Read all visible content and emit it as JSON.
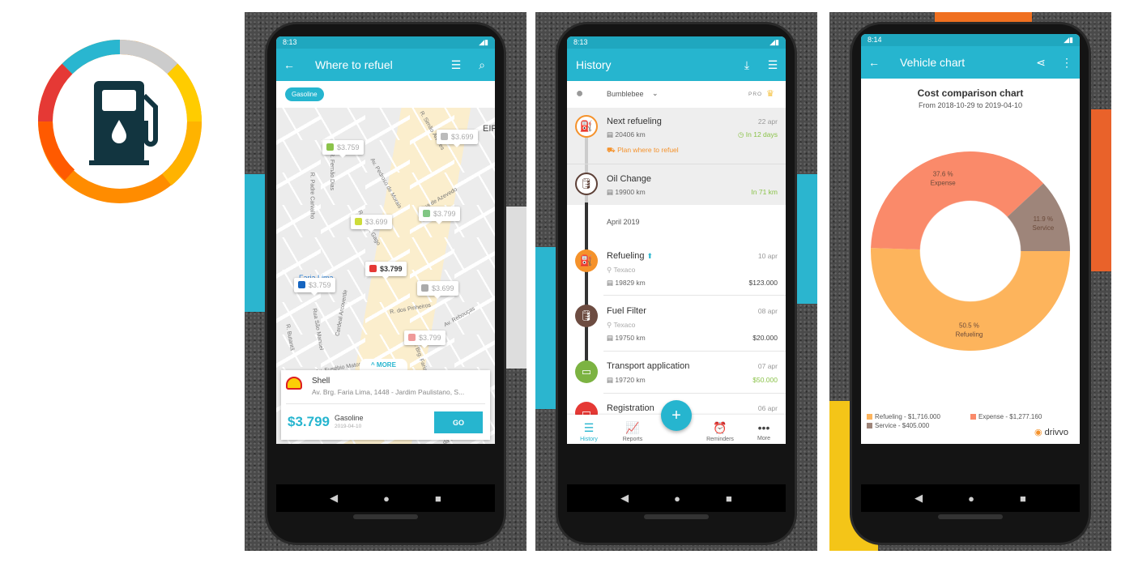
{
  "logo": {
    "name": "fuel-pump-logo",
    "ring_colors": [
      "#29b6d0",
      "#cccccc",
      "#ffcc00",
      "#ffb300",
      "#ff8c00",
      "#ff5a00",
      "#e53935"
    ],
    "pump_color": "#123540"
  },
  "screen1": {
    "time": "8:13",
    "title": "Where to refuel",
    "chip": "Gasoline",
    "markers": [
      {
        "price": "$3.759",
        "color": "#8bc34a"
      },
      {
        "price": "$3.699",
        "color": "#bbb"
      },
      {
        "price": "$3.699",
        "color": "#cddc39"
      },
      {
        "price": "$3.799",
        "color": "#81c784"
      },
      {
        "price": "$3.799",
        "color": "#e53935",
        "selected": true
      },
      {
        "price": "$3.759",
        "color": "#1565c0"
      },
      {
        "price": "$3.699",
        "color": "#aaa"
      },
      {
        "price": "$3.799",
        "color": "#ef9a9a"
      }
    ],
    "streets": [
      "R. Simão Álvares",
      "R. Fernão Dias",
      "R. Padre Carvalho",
      "Av. Pedroso de Morais",
      "Rua de Azevedo",
      "R. Cunha Gago",
      "Faria Lima",
      "R. dos Pinheiros",
      "Rua São Manuel",
      "Cardeal Arcoverde",
      "R. Butantã",
      "Av. Rebouças",
      "Av. Eusébio Matoso",
      "Av. Brg. Faria Lima",
      "R. Mandurí",
      "Paulo Flexa",
      "da Silva",
      "EIRO"
    ],
    "more": "MORE",
    "station": {
      "name": "Shell",
      "address": "Av. Brg. Faria Lima, 1448 - Jardim Paulistano, S...",
      "price": "$3.799",
      "fuel": "Gasoline",
      "date": "2019-04-10",
      "go": "GO"
    }
  },
  "screen2": {
    "time": "8:13",
    "title": "History",
    "vehicle": "Bumblebee",
    "pro": "PRO",
    "upcoming": [
      {
        "title": "Next refueling",
        "odometer": "20406 km",
        "date": "22 apr",
        "due": "In 12 days",
        "link": "Plan where to refuel",
        "color": "#f5922b"
      },
      {
        "title": "Oil Change",
        "odometer": "19900 km",
        "due": "In 71 km",
        "color": "#5d4037"
      }
    ],
    "month": "April 2019",
    "items": [
      {
        "title": "Refueling",
        "place": "Texaco",
        "odometer": "19829 km",
        "date": "10 apr",
        "amount": "$123.000",
        "color": "#f5922b"
      },
      {
        "title": "Fuel Filter",
        "place": "Texaco",
        "odometer": "19750 km",
        "date": "08 apr",
        "amount": "$20.000",
        "color": "#6d4c41"
      },
      {
        "title": "Transport application",
        "odometer": "19720 km",
        "date": "07 apr",
        "amount": "$50.000",
        "color": "#7cb342"
      },
      {
        "title": "Registration",
        "date": "06 apr",
        "color": "#e53935"
      }
    ],
    "bottom_nav": [
      "History",
      "Reports",
      "Reminders",
      "More"
    ],
    "fab": "+"
  },
  "screen3": {
    "time": "8:14",
    "title": "Vehicle chart",
    "brand": "drivvo",
    "chart_data": {
      "type": "pie",
      "donut": true,
      "title": "Cost comparison chart",
      "subtitle": "From 2018-10-29 to 2019-04-10",
      "series": [
        {
          "name": "Refueling",
          "percent": 50.5,
          "label": "50.5 %",
          "value": "$1,716.000",
          "color": "#fdb45c"
        },
        {
          "name": "Expense",
          "percent": 37.6,
          "label": "37.6 %",
          "value": "$1,277.160",
          "color": "#fa8a6a"
        },
        {
          "name": "Service",
          "percent": 11.9,
          "label": "11.9 %",
          "value": "$405.000",
          "color": "#9e857a"
        }
      ],
      "legend": [
        "Refueling - $1,716.000",
        "Expense - $1,277.160",
        "Service - $405.000"
      ],
      "legend_placement": "bottom"
    }
  }
}
